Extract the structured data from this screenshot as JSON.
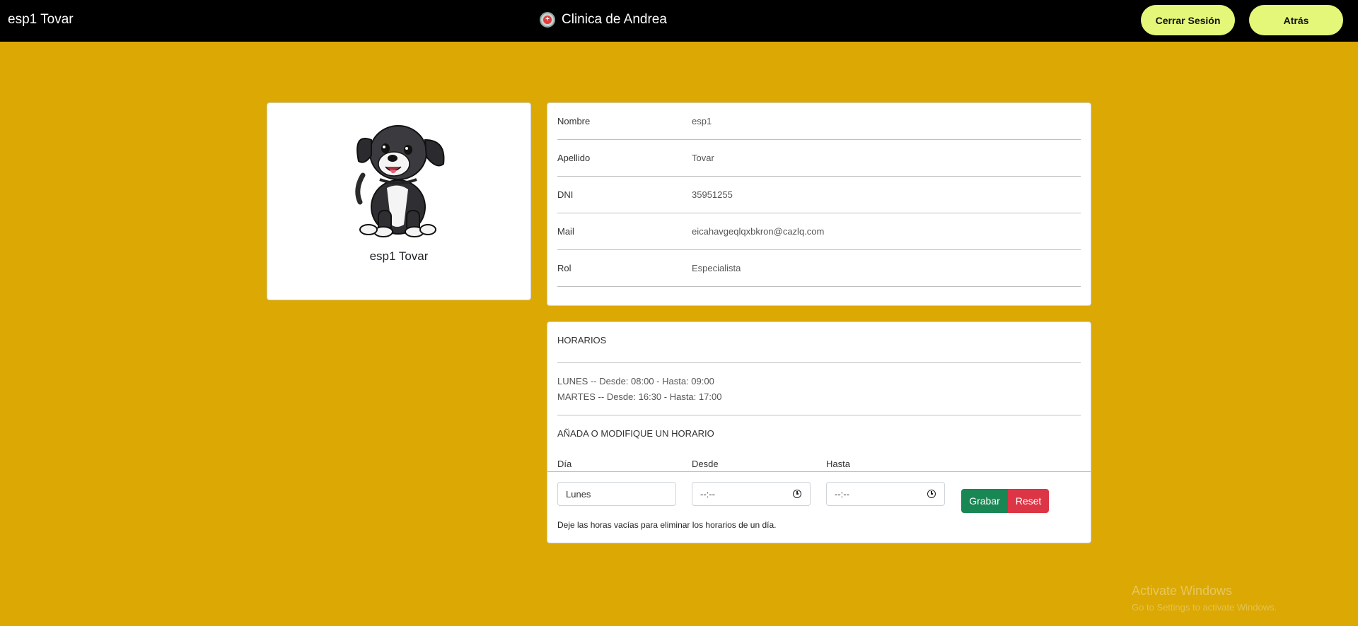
{
  "navbar": {
    "user_name": "esp1 Tovar",
    "brand": "Clinica de Andrea",
    "logout_label": "Cerrar Sesión",
    "back_label": "Atrás"
  },
  "profile": {
    "display_name": "esp1 Tovar",
    "avatar_icon": "cartoon-dog-avatar"
  },
  "info": {
    "rows": [
      {
        "label": "Nombre",
        "value": "esp1"
      },
      {
        "label": "Apellido",
        "value": "Tovar"
      },
      {
        "label": "DNI",
        "value": "35951255"
      },
      {
        "label": "Mail",
        "value": "eicahavgeqlqxbkron@cazlq.com"
      },
      {
        "label": "Rol",
        "value": "Especialista"
      }
    ]
  },
  "schedule": {
    "title": "HORARIOS",
    "entries": [
      "LUNES -- Desde: 08:00 - Hasta: 09:00",
      "MARTES -- Desde: 16:30 - Hasta: 17:00"
    ],
    "form_title": "AÑADA O MODIFIQUE UN HORARIO",
    "labels": {
      "day": "Día",
      "from": "Desde",
      "to": "Hasta"
    },
    "day_value": "Lunes",
    "from_value": "--:--",
    "to_value": "--:--",
    "save_label": "Grabar",
    "reset_label": "Reset",
    "hint": "Deje las horas vacías para eliminar los horarios de un día."
  },
  "watermark": {
    "title": "Activate Windows",
    "subtitle": "Go to Settings to activate Windows."
  },
  "colors": {
    "background": "#dba804",
    "navbar": "#000000",
    "nav_button": "#e4f779",
    "save": "#198754",
    "reset": "#dc3545"
  }
}
